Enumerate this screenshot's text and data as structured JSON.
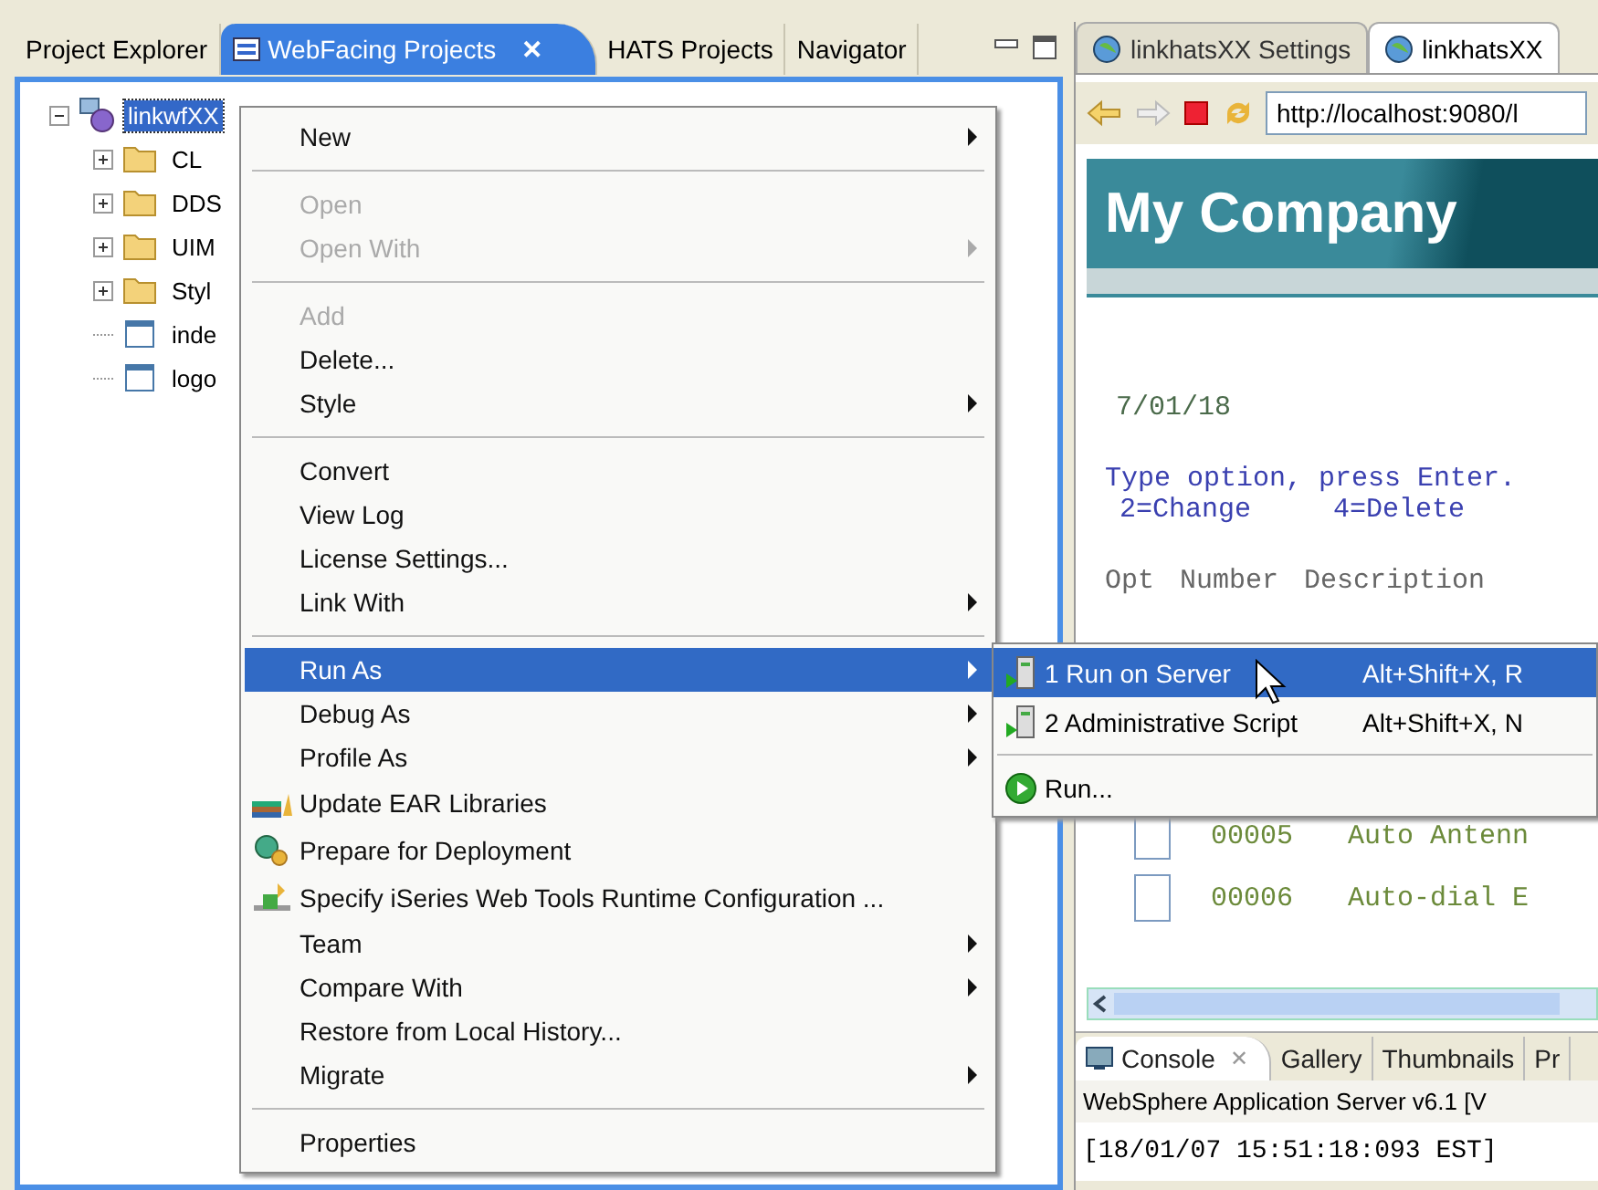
{
  "left_panel": {
    "tabs": [
      {
        "label": "Project Explorer",
        "selected": false
      },
      {
        "label": "WebFacing Projects",
        "selected": true,
        "close": "✕"
      },
      {
        "label": "HATS Projects",
        "selected": false
      },
      {
        "label": "Navigator",
        "selected": false
      }
    ],
    "tree": [
      {
        "label": "linkwfXX",
        "selected": true,
        "expanded": true,
        "children": [
          {
            "label": "CL",
            "expanded": false
          },
          {
            "label": "DDS",
            "expanded": false
          },
          {
            "label": "UIM",
            "expanded": false
          },
          {
            "label": "Styl",
            "expanded": false
          },
          {
            "label": "inde"
          },
          {
            "label": "logo"
          }
        ]
      }
    ]
  },
  "context_menu": [
    {
      "kind": "item",
      "label": "New",
      "submenu": true,
      "disabled": false,
      "selected": false
    },
    {
      "kind": "separator"
    },
    {
      "kind": "item",
      "label": "Open",
      "submenu": false,
      "disabled": true,
      "selected": false
    },
    {
      "kind": "item",
      "label": "Open With",
      "submenu": true,
      "disabled": true,
      "selected": false
    },
    {
      "kind": "separator"
    },
    {
      "kind": "item",
      "label": "Add",
      "submenu": false,
      "disabled": true,
      "selected": false
    },
    {
      "kind": "item",
      "label": "Delete...",
      "submenu": false,
      "disabled": false,
      "selected": false
    },
    {
      "kind": "item",
      "label": "Style",
      "submenu": true,
      "disabled": false,
      "selected": false
    },
    {
      "kind": "separator"
    },
    {
      "kind": "item",
      "label": "Convert",
      "submenu": false,
      "disabled": false,
      "selected": false
    },
    {
      "kind": "item",
      "label": "View Log",
      "submenu": false,
      "disabled": false,
      "selected": false
    },
    {
      "kind": "item",
      "label": "License Settings...",
      "submenu": false,
      "disabled": false,
      "selected": false
    },
    {
      "kind": "item",
      "label": "Link With",
      "submenu": true,
      "disabled": false,
      "selected": false
    },
    {
      "kind": "separator"
    },
    {
      "kind": "item",
      "label": "Run As",
      "submenu": true,
      "disabled": false,
      "selected": true
    },
    {
      "kind": "item",
      "label": "Debug As",
      "submenu": true,
      "disabled": false,
      "selected": false
    },
    {
      "kind": "item",
      "label": "Profile As",
      "submenu": true,
      "disabled": false,
      "selected": false
    },
    {
      "kind": "icon-item",
      "label": "Update EAR Libraries",
      "submenu": false,
      "disabled": false,
      "selected": false
    },
    {
      "kind": "icon-item",
      "label": "Prepare for Deployment",
      "submenu": false,
      "disabled": false,
      "selected": false
    },
    {
      "kind": "icon-item",
      "label": "Specify iSeries Web Tools Runtime Configuration ...",
      "submenu": false,
      "disabled": false,
      "selected": false
    },
    {
      "kind": "item",
      "label": "Team",
      "submenu": true,
      "disabled": false,
      "selected": false
    },
    {
      "kind": "item",
      "label": "Compare With",
      "submenu": true,
      "disabled": false,
      "selected": false
    },
    {
      "kind": "item",
      "label": "Restore from Local History...",
      "submenu": false,
      "disabled": false,
      "selected": false
    },
    {
      "kind": "item",
      "label": "Migrate",
      "submenu": true,
      "disabled": false,
      "selected": false
    },
    {
      "kind": "separator"
    },
    {
      "kind": "item",
      "label": "Properties",
      "submenu": false,
      "disabled": false,
      "selected": false
    }
  ],
  "submenu": [
    {
      "kind": "item",
      "label": "1 Run on Server",
      "shortcut": "Alt+Shift+X, R",
      "selected": true
    },
    {
      "kind": "item",
      "label": "2 Administrative Script",
      "shortcut": "Alt+Shift+X, N",
      "selected": false
    },
    {
      "kind": "separator"
    },
    {
      "kind": "run",
      "label": "Run...",
      "selected": false
    }
  ],
  "right_panel": {
    "tabs": [
      {
        "label": "linkhatsXX Settings",
        "selected": false
      },
      {
        "label": "linkhatsXX",
        "selected": true
      }
    ],
    "url": "http://localhost:9080/l",
    "banner": "My Company",
    "date": "7/01/18",
    "instruction": "Type option, press Enter.",
    "options": [
      "2=Change",
      "4=Delete"
    ],
    "columns": [
      "Opt",
      "Number",
      "Description"
    ],
    "rows": [
      {
        "number": "00005",
        "description": "Auto Antenn"
      },
      {
        "number": "00006",
        "description": "Auto-dial E"
      }
    ]
  },
  "console": {
    "tabs": [
      {
        "label": "Console",
        "selected": true,
        "close": "✕"
      },
      {
        "label": "Gallery",
        "selected": false
      },
      {
        "label": "Thumbnails",
        "selected": false
      },
      {
        "label": "Pr",
        "selected": false
      }
    ],
    "server": "WebSphere Application Server v6.1 [V",
    "log": "[18/01/07 15:51:18:093 EST]"
  }
}
